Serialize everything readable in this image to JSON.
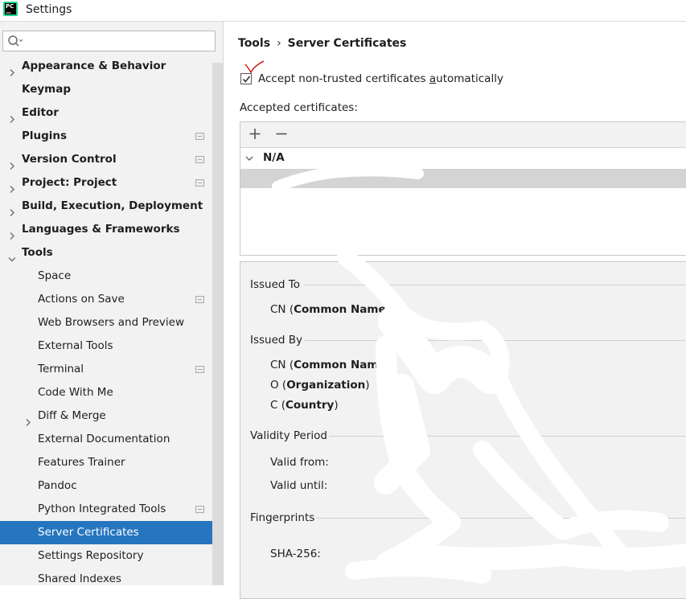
{
  "window": {
    "title": "Settings",
    "logo_text_top": "PC",
    "logo_text_bottom": "—"
  },
  "search": {
    "value": "",
    "placeholder": ""
  },
  "sidebar": {
    "items": [
      {
        "label": "Appearance & Behavior",
        "bold": true,
        "arrow": "right",
        "indent": 0,
        "project_icon": false
      },
      {
        "label": "Keymap",
        "bold": true,
        "arrow": "none",
        "indent": 0,
        "project_icon": false
      },
      {
        "label": "Editor",
        "bold": true,
        "arrow": "right",
        "indent": 0,
        "project_icon": false
      },
      {
        "label": "Plugins",
        "bold": true,
        "arrow": "none",
        "indent": 0,
        "project_icon": true
      },
      {
        "label": "Version Control",
        "bold": true,
        "arrow": "right",
        "indent": 0,
        "project_icon": true
      },
      {
        "label": "Project: Project",
        "bold": true,
        "arrow": "right",
        "indent": 0,
        "project_icon": true
      },
      {
        "label": "Build, Execution, Deployment",
        "bold": true,
        "arrow": "right",
        "indent": 0,
        "project_icon": false
      },
      {
        "label": "Languages & Frameworks",
        "bold": true,
        "arrow": "right",
        "indent": 0,
        "project_icon": false
      },
      {
        "label": "Tools",
        "bold": true,
        "arrow": "down",
        "indent": 0,
        "project_icon": false
      },
      {
        "label": "Space",
        "bold": false,
        "arrow": "none",
        "indent": 1,
        "project_icon": false
      },
      {
        "label": "Actions on Save",
        "bold": false,
        "arrow": "none",
        "indent": 1,
        "project_icon": true
      },
      {
        "label": "Web Browsers and Preview",
        "bold": false,
        "arrow": "none",
        "indent": 1,
        "project_icon": false
      },
      {
        "label": "External Tools",
        "bold": false,
        "arrow": "none",
        "indent": 1,
        "project_icon": false
      },
      {
        "label": "Terminal",
        "bold": false,
        "arrow": "none",
        "indent": 1,
        "project_icon": true
      },
      {
        "label": "Code With Me",
        "bold": false,
        "arrow": "none",
        "indent": 1,
        "project_icon": false
      },
      {
        "label": "Diff & Merge",
        "bold": false,
        "arrow": "right",
        "indent": 1,
        "project_icon": false
      },
      {
        "label": "External Documentation",
        "bold": false,
        "arrow": "none",
        "indent": 1,
        "project_icon": false
      },
      {
        "label": "Features Trainer",
        "bold": false,
        "arrow": "none",
        "indent": 1,
        "project_icon": false
      },
      {
        "label": "Pandoc",
        "bold": false,
        "arrow": "none",
        "indent": 1,
        "project_icon": false
      },
      {
        "label": "Python Integrated Tools",
        "bold": false,
        "arrow": "none",
        "indent": 1,
        "project_icon": true
      },
      {
        "label": "Server Certificates",
        "bold": false,
        "arrow": "none",
        "indent": 1,
        "project_icon": false,
        "selected": true
      },
      {
        "label": "Settings Repository",
        "bold": false,
        "arrow": "none",
        "indent": 1,
        "project_icon": false
      },
      {
        "label": "Shared Indexes",
        "bold": false,
        "arrow": "none",
        "indent": 1,
        "project_icon": false
      }
    ]
  },
  "content": {
    "breadcrumb": {
      "parent": "Tools",
      "separator": "›",
      "current": "Server Certificates"
    },
    "accept_checkbox": {
      "label_before": "Accept non-trusted certificates ",
      "label_mnemonic": "a",
      "label_after": "utomatically",
      "checked": true
    },
    "accepted_label": "Accepted certificates:",
    "toolbar": {
      "add_icon": "plus-icon",
      "remove_icon": "minus-icon"
    },
    "groups": [
      {
        "label": "N/A",
        "expanded": true
      }
    ],
    "details": {
      "issued_to": {
        "title": "Issued To",
        "fields": [
          {
            "prefix": "CN (",
            "bold": "Common Name",
            "suffix": ")"
          }
        ]
      },
      "issued_by": {
        "title": "Issued By",
        "fields": [
          {
            "prefix": "CN (",
            "bold": "Common Name",
            "suffix": ")"
          },
          {
            "prefix": "O (",
            "bold": "Organization",
            "suffix": ")"
          },
          {
            "prefix": "C (",
            "bold": "Country",
            "suffix": ")"
          }
        ]
      },
      "validity": {
        "title": "Validity Period",
        "valid_from": "Valid from:",
        "valid_until": "Valid until:"
      },
      "fingerprints": {
        "title": "Fingerprints",
        "sha256": "SHA-256:"
      }
    }
  },
  "colors": {
    "selection": "#2675bf",
    "sidebar_bg": "#f2f2f2",
    "annotation": "#cc0000"
  }
}
